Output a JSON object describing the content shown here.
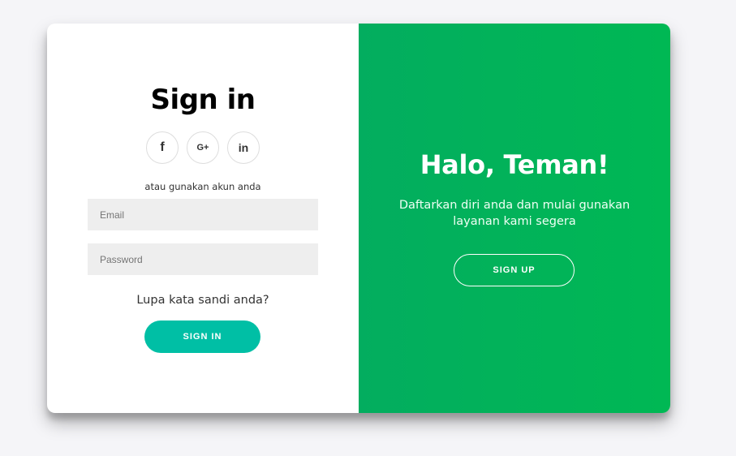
{
  "sign_in": {
    "title": "Sign in",
    "socials": [
      {
        "icon": "facebook-icon",
        "glyph": "f"
      },
      {
        "icon": "google-plus-icon",
        "glyph": "G+"
      },
      {
        "icon": "linkedin-icon",
        "glyph": "in"
      }
    ],
    "alt_text": "atau gunakan akun anda",
    "email_placeholder": "Email",
    "password_placeholder": "Password",
    "forgot_link": "Lupa kata sandi anda?",
    "button_label": "SIGN IN"
  },
  "overlay": {
    "title": "Halo, Teman!",
    "text": "Daftarkan diri anda dan mulai gunakan layanan kami segera",
    "button_label": "SIGN UP"
  },
  "colors": {
    "accent": "#00bfa5",
    "panel_green_start": "#03ad5f",
    "panel_green_end": "#00b854"
  }
}
